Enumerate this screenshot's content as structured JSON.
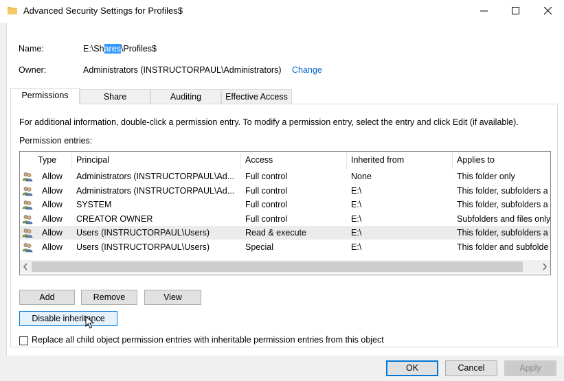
{
  "window": {
    "title": "Advanced Security Settings for Profiles$"
  },
  "name": {
    "label": "Name:",
    "value_prefix": "E:\\Sh",
    "value_selected": "ares",
    "value_suffix": "\\Profiles$"
  },
  "owner": {
    "label": "Owner:",
    "value": "Administrators (INSTRUCTORPAUL\\Administrators)",
    "change_link": "Change"
  },
  "tabs": [
    {
      "label": "Permissions",
      "active": true
    },
    {
      "label": "Share"
    },
    {
      "label": "Auditing"
    },
    {
      "label": "Effective Access"
    }
  ],
  "permissions": {
    "info_text": "For additional information, double-click a permission entry. To modify a permission entry, select the entry and click Edit (if available).",
    "entries_label": "Permission entries:",
    "columns": [
      "Type",
      "Principal",
      "Access",
      "Inherited from",
      "Applies to"
    ],
    "rows": [
      {
        "type": "Allow",
        "principal": "Administrators (INSTRUCTORPAUL\\Ad...",
        "access": "Full control",
        "inherited": "None",
        "applies": "This folder only"
      },
      {
        "type": "Allow",
        "principal": "Administrators (INSTRUCTORPAUL\\Ad...",
        "access": "Full control",
        "inherited": "E:\\",
        "applies": "This folder, subfolders a"
      },
      {
        "type": "Allow",
        "principal": "SYSTEM",
        "access": "Full control",
        "inherited": "E:\\",
        "applies": "This folder, subfolders a"
      },
      {
        "type": "Allow",
        "principal": "CREATOR OWNER",
        "access": "Full control",
        "inherited": "E:\\",
        "applies": "Subfolders and files only"
      },
      {
        "type": "Allow",
        "principal": "Users (INSTRUCTORPAUL\\Users)",
        "access": "Read & execute",
        "inherited": "E:\\",
        "applies": "This folder, subfolders a"
      },
      {
        "type": "Allow",
        "principal": "Users (INSTRUCTORPAUL\\Users)",
        "access": "Special",
        "inherited": "E:\\",
        "applies": "This folder and subfolde"
      }
    ],
    "add_label": "Add",
    "remove_label": "Remove",
    "view_label": "View",
    "disable_inheritance_label": "Disable inheritance",
    "replace_label": "Replace all child object permission entries with inheritable permission entries from this object"
  },
  "footer": {
    "ok_label": "OK",
    "cancel_label": "Cancel",
    "apply_label": "Apply"
  },
  "colors": {
    "accent": "#0078d7",
    "selection": "#3399ff",
    "link": "#0066cc"
  }
}
